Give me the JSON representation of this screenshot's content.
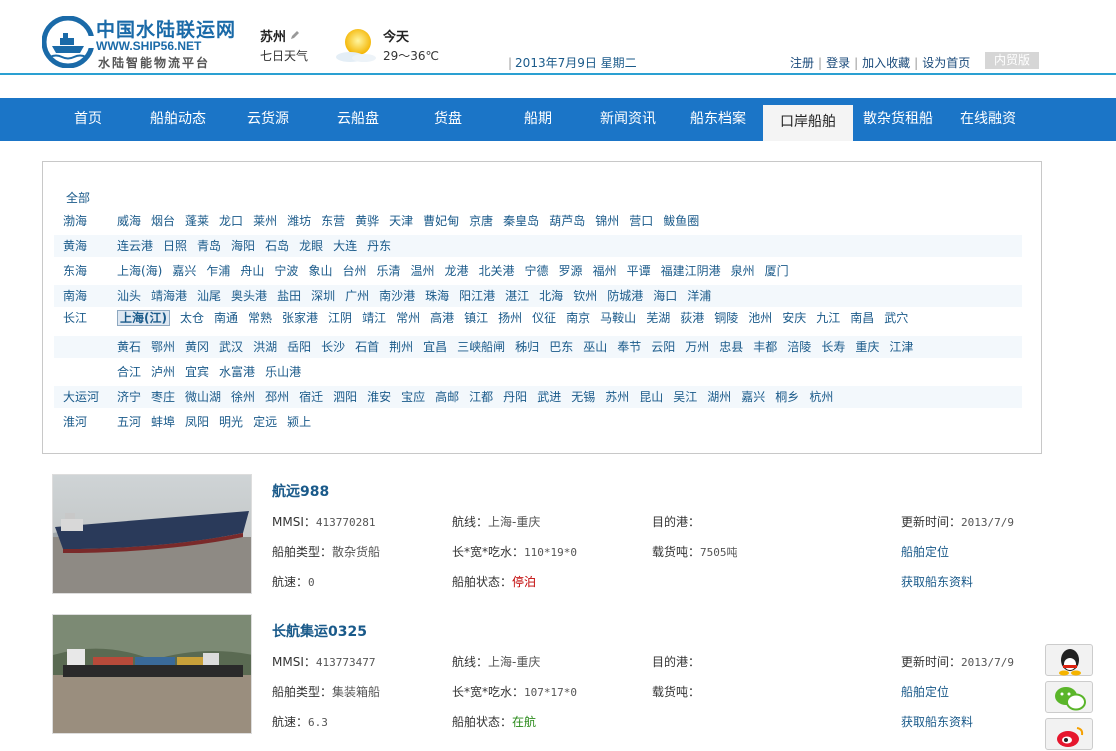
{
  "logo": {
    "name_cn": "中国水陆联运网",
    "url": "WWW.SHIP56.NET",
    "slogan": "水陆智能物流平台"
  },
  "header": {
    "city": "苏州",
    "weather_link": "七日天气",
    "today": "今天",
    "temperature": "29～36℃",
    "date": "2013年7月9日  星期二",
    "links": [
      "注册",
      "登录",
      "加入收藏",
      "设为首页"
    ],
    "domestic": "内贸版"
  },
  "nav": {
    "items": [
      "首页",
      "船舶动态",
      "云货源",
      "云船盘",
      "货盘",
      "船期",
      "新闻资讯",
      "船东档案",
      "口岸船舶",
      "散杂货租船",
      "在线融资"
    ],
    "active_index": 8
  },
  "ports": {
    "all": "全部",
    "regions": [
      {
        "name": "渤海",
        "ports": [
          "威海",
          "烟台",
          "蓬莱",
          "龙口",
          "莱州",
          "潍坊",
          "东营",
          "黄骅",
          "天津",
          "曹妃甸",
          "京唐",
          "秦皇岛",
          "葫芦岛",
          "锦州",
          "营口",
          "鲅鱼圈"
        ]
      },
      {
        "name": "黄海",
        "ports": [
          "连云港",
          "日照",
          "青岛",
          "海阳",
          "石岛",
          "龙眼",
          "大连",
          "丹东"
        ]
      },
      {
        "name": "东海",
        "ports": [
          "上海(海)",
          "嘉兴",
          "乍浦",
          "舟山",
          "宁波",
          "象山",
          "台州",
          "乐清",
          "温州",
          "龙港",
          "北关港",
          "宁德",
          "罗源",
          "福州",
          "平谭",
          "福建江阴港",
          "泉州",
          "厦门"
        ]
      },
      {
        "name": "南海",
        "ports": [
          "汕头",
          "靖海港",
          "汕尾",
          "奥头港",
          "盐田",
          "深圳",
          "广州",
          "南沙港",
          "珠海",
          "阳江港",
          "湛江",
          "北海",
          "钦州",
          "防城港",
          "海口",
          "洋浦"
        ]
      },
      {
        "name": "长江",
        "ports": [
          "上海(江)",
          "太仓",
          "南通",
          "常熟",
          "张家港",
          "江阴",
          "靖江",
          "常州",
          "高港",
          "镇江",
          "扬州",
          "仪征",
          "南京",
          "马鞍山",
          "芜湖",
          "荻港",
          "铜陵",
          "池州",
          "安庆",
          "九江",
          "南昌",
          "武穴"
        ],
        "active": "上海(江)"
      },
      {
        "name": "",
        "ports": [
          "黄石",
          "鄂州",
          "黄冈",
          "武汉",
          "洪湖",
          "岳阳",
          "长沙",
          "石首",
          "荆州",
          "宜昌",
          "三峡船闸",
          "秭归",
          "巴东",
          "巫山",
          "奉节",
          "云阳",
          "万州",
          "忠县",
          "丰都",
          "涪陵",
          "长寿",
          "重庆",
          "江津"
        ]
      },
      {
        "name": "",
        "ports": [
          "合江",
          "泸州",
          "宜宾",
          "水富港",
          "乐山港"
        ]
      },
      {
        "name": "大运河",
        "ports": [
          "济宁",
          "枣庄",
          "微山湖",
          "徐州",
          "邳州",
          "宿迁",
          "泗阳",
          "淮安",
          "宝应",
          "高邮",
          "江都",
          "丹阳",
          "武进",
          "无锡",
          "苏州",
          "昆山",
          "吴江",
          "湖州",
          "嘉兴",
          "桐乡",
          "杭州"
        ]
      },
      {
        "name": "淮河",
        "ports": [
          "五河",
          "蚌埠",
          "凤阳",
          "明光",
          "定远",
          "颍上"
        ]
      }
    ]
  },
  "labels": {
    "mmsi": "MMSI：",
    "route": "航线：",
    "dest": "目的港：",
    "updated": "更新时间：",
    "type": "船舶类型：",
    "dims": "长*宽*吃水：",
    "tonnage": "载货吨：",
    "speed": "航速：",
    "status": "船舶状态：",
    "locate": "船舶定位",
    "owner_info": "获取船东资料"
  },
  "ships": [
    {
      "name": "航远988",
      "mmsi": "413770281",
      "route": "上海-重庆",
      "dest": "",
      "updated": "2013/7/9",
      "type": "散杂货船",
      "dims": "110*19*0",
      "tonnage": "7505吨",
      "speed": "0",
      "status": "停泊"
    },
    {
      "name": "长航集运0325",
      "mmsi": "413773477",
      "route": "上海-重庆",
      "dest": "",
      "updated": "2013/7/9",
      "type": "集装箱船",
      "dims": "107*17*0",
      "tonnage": "",
      "speed": "6.3",
      "status": "在航"
    }
  ],
  "colors": {
    "nav_bg": "#1b75c7",
    "accent_line": "#2aa0d2",
    "link": "#1a5a8a",
    "moored": "#c00000",
    "sailing": "#2a8a1a"
  },
  "float_icons": [
    "qq-icon",
    "wechat-icon",
    "weibo-icon"
  ]
}
